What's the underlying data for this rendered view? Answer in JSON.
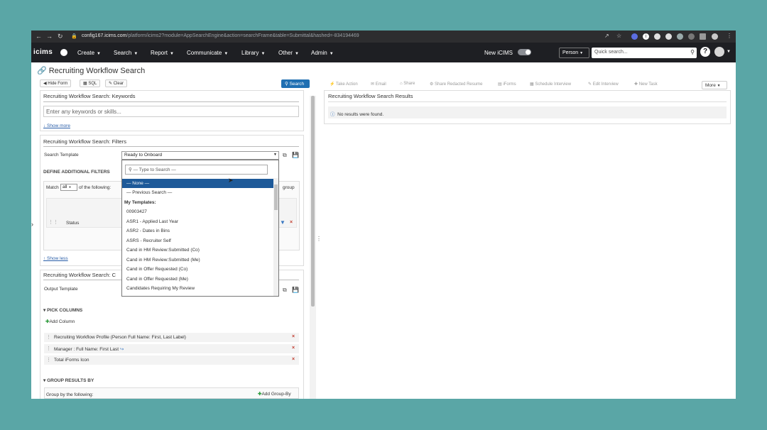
{
  "browser": {
    "url_host": "config167.icims.com",
    "url_path": "/platform/icims2?module=AppSearchEngine&action=searchFrame&table=Submittal&hashed=-834194469"
  },
  "appnav": {
    "logo": "icims",
    "menus": [
      "Create",
      "Search",
      "Report",
      "Communicate",
      "Library",
      "Other",
      "Admin"
    ],
    "new_icims": "New iCIMS",
    "person_select": "Person",
    "quick_search_placeholder": "Quick search..."
  },
  "page": {
    "title": "Recruiting Workflow Search",
    "buttons": {
      "hide_form": "Hide Form",
      "sql": "SQL",
      "clear": "Clear",
      "search": "Search"
    }
  },
  "keywords": {
    "heading": "Recruiting Workflow Search: Keywords",
    "placeholder": "Enter any keywords or skills...",
    "show_more": "↓ Show more"
  },
  "filters": {
    "heading": "Recruiting Workflow Search: Filters",
    "search_template_label": "Search Template",
    "search_template_value": "Ready to Onboard",
    "define_label": "DEFINE ADDITIONAL FILTERS",
    "match_prefix": "Match",
    "match_value": "all",
    "match_suffix": "of the following:",
    "group_label": "group",
    "status_label": "Status",
    "show_less": "↑ Show less"
  },
  "columns": {
    "heading": "Recruiting Workflow Search: C",
    "output_template_label": "Output Template",
    "pick_columns": "▾ PICK COLUMNS",
    "add_column": "Add Column",
    "items": [
      "Recruiting Workflow Profile (Person Full Name: First, Last Label)",
      "Manager : Full Name: First Last",
      "Total iForms Icon"
    ],
    "group_results": "▾ GROUP RESULTS BY",
    "group_by_label": "Group by the following:",
    "add_group_by": "Add Group-By"
  },
  "dropdown": {
    "search_placeholder": "— Type to Search —",
    "options": [
      {
        "label": "— None —",
        "selected": true
      },
      {
        "label": "— Previous Search —"
      },
      {
        "label": "My Templates:",
        "group": true
      },
      {
        "label": "00903427"
      },
      {
        "label": "ASR1 - Applied Last Year"
      },
      {
        "label": "ASR2 - Dates in Bins"
      },
      {
        "label": "ASRS - Recruiter Self"
      },
      {
        "label": "Cand in HM Review:Submitted (Co)"
      },
      {
        "label": "Cand in HM Review:Submitted (Me)"
      },
      {
        "label": "Cand in Offer Requested (Co)"
      },
      {
        "label": "Cand in Offer Requested (Me)"
      },
      {
        "label": "Candidates Requiring My Review"
      }
    ]
  },
  "results": {
    "toolbar": [
      "Take Action",
      "Email",
      "Share",
      "Share Redacted Resume",
      "iForms",
      "Schedule Interview",
      "Edit Interview",
      "New Task"
    ],
    "more": "More",
    "heading": "Recruiting Workflow Search Results",
    "message": "No results were found."
  },
  "colors": {
    "accent": "#1f6fb2",
    "nav_bg": "#1e1f23",
    "selected_option": "#1e5a99",
    "remove": "#c0392b"
  }
}
